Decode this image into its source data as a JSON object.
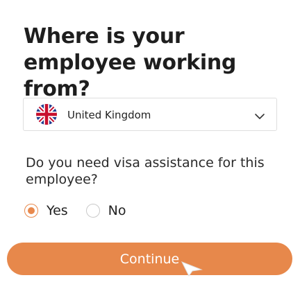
{
  "form": {
    "title": "Where is your employee working from?",
    "country": {
      "selected": "United Kingdom",
      "flag_icon": "uk-flag-icon",
      "dropdown_icon": "chevron-down-icon"
    },
    "visa_question": "Do you need visa assistance for this employee?",
    "visa_options": [
      {
        "label": "Yes",
        "checked": true
      },
      {
        "label": "No",
        "checked": false
      }
    ],
    "continue_label": "Continue"
  },
  "colors": {
    "accent": "#e7884b",
    "border": "#dedede",
    "text": "#1e1e1e"
  }
}
